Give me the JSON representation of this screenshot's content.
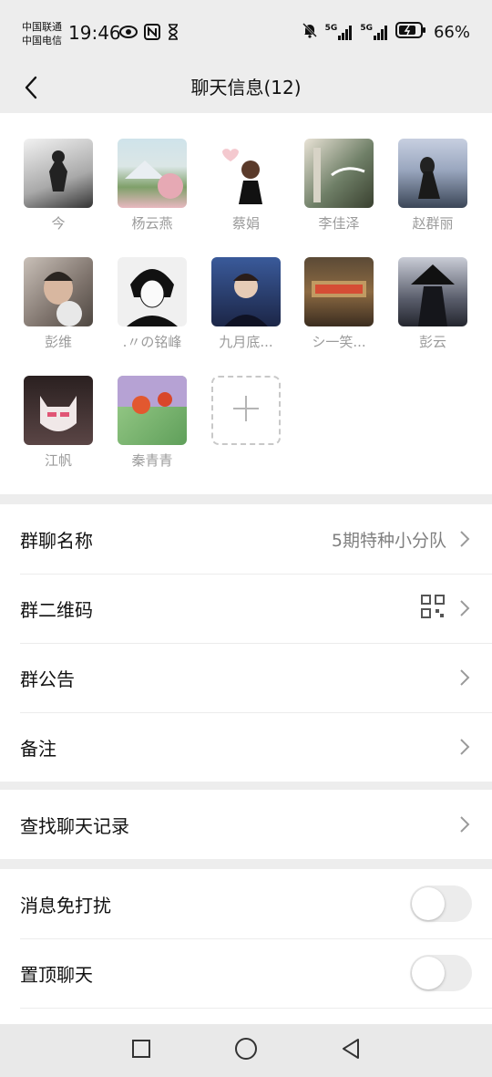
{
  "status_bar": {
    "carrier1": "中国联通",
    "carrier2": "中国电信",
    "time": "19:46",
    "network1": "5G",
    "network2": "5G",
    "battery": "66%"
  },
  "header": {
    "title": "聊天信息(12)",
    "back_icon": "chevron-left-icon"
  },
  "members": [
    {
      "name": "今",
      "color": "#d8d8d8"
    },
    {
      "name": "杨云燕",
      "color": "#9fb7b1"
    },
    {
      "name": "蔡娟",
      "color": "#ffffff"
    },
    {
      "name": "李佳泽",
      "color": "#7d8a72"
    },
    {
      "name": "赵群丽",
      "color": "#5e6d82"
    },
    {
      "name": "彭维",
      "color": "#8c7f77"
    },
    {
      "name": ".〃の铭峰",
      "color": "#cfcfcf"
    },
    {
      "name": "九月底...",
      "color": "#23305a"
    },
    {
      "name": "シ一笑...",
      "color": "#6b5133"
    },
    {
      "name": "彭云",
      "color": "#3c4050"
    },
    {
      "name": "江帆",
      "color": "#5a4545"
    },
    {
      "name": "秦青青",
      "color": "#6fa66b"
    }
  ],
  "add_member_icon": "plus-icon",
  "settings": {
    "group_name_label": "群聊名称",
    "group_name_value": "5期特种小分队",
    "qr_label": "群二维码",
    "notice_label": "群公告",
    "remark_label": "备注",
    "search_label": "查找聊天记录",
    "mute_label": "消息免打扰",
    "pin_label": "置顶聊天",
    "mute_on": false,
    "pin_on": false
  },
  "colors": {
    "background": "#ededed",
    "accent_green": "#07c160"
  }
}
